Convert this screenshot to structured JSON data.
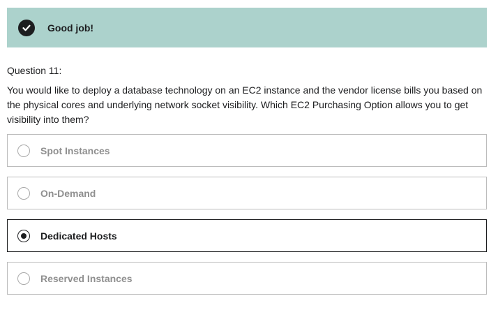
{
  "banner": {
    "icon": "check-circle-icon",
    "message": "Good job!",
    "color": "#acd2cc"
  },
  "question": {
    "number_label": "Question 11:",
    "text": "You would like to deploy a database technology on an EC2 instance and the vendor license bills you based on the physical cores and underlying network socket visibility. Which EC2 Purchasing Option allows you to get visibility into them?"
  },
  "options": [
    {
      "label": "Spot Instances",
      "selected": false
    },
    {
      "label": "On-Demand",
      "selected": false
    },
    {
      "label": "Dedicated Hosts",
      "selected": true
    },
    {
      "label": "Reserved Instances",
      "selected": false
    }
  ]
}
